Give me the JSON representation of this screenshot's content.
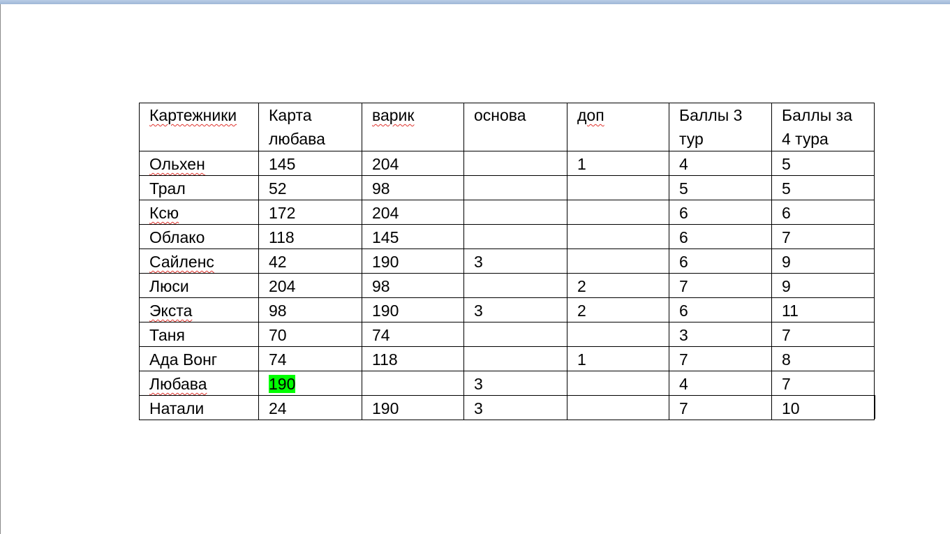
{
  "table": {
    "headers": [
      "Картежники",
      "Карта любава",
      "варик",
      "основа",
      "доп",
      "Баллы 3 тур",
      "Баллы за 4 тура"
    ],
    "rows": [
      [
        "Ольхен",
        "145",
        "204",
        "",
        "1",
        "4",
        "5"
      ],
      [
        "Трал",
        "52",
        "98",
        "",
        "",
        "5",
        "5"
      ],
      [
        "Ксю",
        "172",
        "204",
        "",
        "",
        "6",
        "6"
      ],
      [
        "Облако",
        "118",
        "145",
        "",
        "",
        "6",
        "7"
      ],
      [
        "Сайленс",
        "42",
        "190",
        "3",
        "",
        "6",
        "9"
      ],
      [
        "Люси",
        "204",
        "98",
        "",
        "2",
        "7",
        "9"
      ],
      [
        "Экста",
        "98",
        "190",
        "3",
        "2",
        "6",
        "11"
      ],
      [
        "Таня",
        "70",
        "74",
        "",
        "",
        "3",
        "7"
      ],
      [
        "Ада Вонг",
        "74",
        "118",
        "",
        "1",
        "7",
        "8"
      ],
      [
        "Любава",
        "190",
        "",
        "3",
        "",
        "4",
        "7"
      ],
      [
        "Натали",
        "24",
        "190",
        "3",
        "",
        "7",
        "10"
      ]
    ],
    "highlight_color": "#00ff00"
  }
}
